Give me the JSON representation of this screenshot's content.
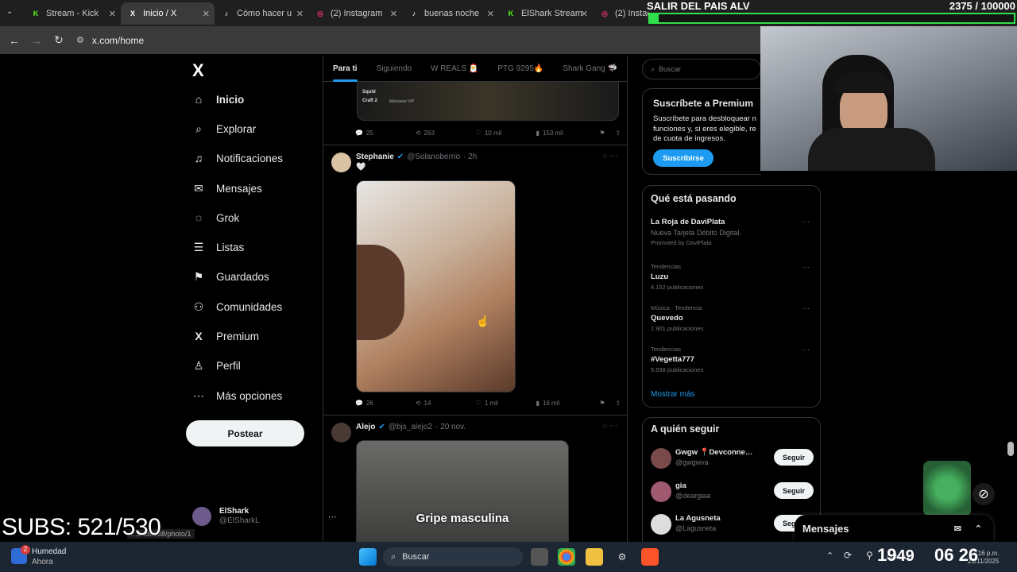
{
  "browser": {
    "tabs": [
      {
        "label": "Stream - Kick",
        "fav": "K",
        "fav_color": "#53fc18"
      },
      {
        "label": "Inicio / X",
        "fav": "X",
        "fav_color": "#ffffff"
      },
      {
        "label": "Cómo hacer u",
        "fav": "♪",
        "fav_color": "#ffffff"
      },
      {
        "label": "(2) Instagram",
        "fav": "◎",
        "fav_color": "#e1306c"
      },
      {
        "label": "buenas noche",
        "fav": "♪",
        "fav_color": "#ffffff"
      },
      {
        "label": "ElShark Stream",
        "fav": "K",
        "fav_color": "#53fc18"
      },
      {
        "label": "(2) Instagram",
        "fav": "◎",
        "fav_color": "#e1306c"
      }
    ],
    "url": "x.com/home",
    "status_link": "…8486038/photo/1"
  },
  "overlay": {
    "goal_text": "SALIR DEL PAIS ALV",
    "goal_count": "2375 / 100000",
    "subs": "SUBS: 521/530"
  },
  "sidebar": {
    "logo": "X",
    "items": [
      {
        "label": "Inicio",
        "icon": "⌂"
      },
      {
        "label": "Explorar",
        "icon": "⌕"
      },
      {
        "label": "Notificaciones",
        "icon": "♫"
      },
      {
        "label": "Mensajes",
        "icon": "✉"
      },
      {
        "label": "Grok",
        "icon": "◌"
      },
      {
        "label": "Listas",
        "icon": "☰"
      },
      {
        "label": "Guardados",
        "icon": "⚑"
      },
      {
        "label": "Comunidades",
        "icon": "⚇"
      },
      {
        "label": "Premium",
        "icon": "X"
      },
      {
        "label": "Perfil",
        "icon": "♙"
      },
      {
        "label": "Más opciones",
        "icon": "⋯"
      }
    ],
    "post_button": "Postear",
    "profile_name": "ElShark",
    "profile_handle": "@ElSharkL"
  },
  "feed": {
    "tabs": [
      "Para ti",
      "Siguiendo",
      "W REALS 🎅",
      "PTG 9295🔥",
      "Shark Gang 🦈"
    ],
    "post0": {
      "media_caption": "Squid Craft 2",
      "media_sub": "Máscaras VIP",
      "replies": "25",
      "reposts": "263",
      "likes": "10 mil",
      "views": "153 mil"
    },
    "post1": {
      "name": "Stephanie",
      "handle": "@Solanoberrio",
      "time": "· 2h",
      "text": "🤍",
      "replies": "26",
      "reposts": "14",
      "likes": "1 mil",
      "views": "16 mil"
    },
    "post2": {
      "name": "Alejo",
      "handle": "@bjs_alejo2",
      "time": "· 20 nov.",
      "media_caption": "Gripe masculina"
    }
  },
  "right": {
    "search_placeholder": "Buscar",
    "premium": {
      "title": "Suscríbete a Premium",
      "body1": "Suscríbete para desbloquear n",
      "body2": "funciones y, si eres elegible, re",
      "body3": "de cuota de ingresos.",
      "button": "Suscribirse"
    },
    "trends_title": "Qué está pasando",
    "trends": [
      {
        "meta": "",
        "name": "La Roja de DaviPlata",
        "sub": "Nueva Tarjeta Débito Digital.",
        "extra": "Promoted by DaviPlata"
      },
      {
        "meta": "Tendencias",
        "name": "Luzu",
        "sub": "4.152 publicaciones",
        "extra": ""
      },
      {
        "meta": "Música · Tendencia",
        "name": "Quevedo",
        "sub": "1.901 publicaciones",
        "extra": ""
      },
      {
        "meta": "Tendencias",
        "name": "#Vegetta777",
        "sub": "5.938 publicaciones",
        "extra": ""
      }
    ],
    "show_more": "Mostrar más",
    "follow_title": "A quién seguir",
    "follow": [
      {
        "name": "Gwgw 📍Devconne…",
        "handle": "@gwgwva",
        "button": "Seguir"
      },
      {
        "name": "gia",
        "handle": "@deargiaa",
        "button": "Seguir"
      },
      {
        "name": "La Agusneta",
        "handle": "@Lagusneta",
        "button": "Seguir"
      }
    ],
    "messages": "Mensajes"
  },
  "taskbar": {
    "weather": "Humedad",
    "weather_sub": "Ahora",
    "search": "Buscar",
    "clock1": "19",
    "clock2": "49",
    "clock3": "06",
    "clock4": "26",
    "time_small": "7:16 p.m.",
    "date_small": "21/11/2025",
    "lang": "ESP LAA",
    "notif_count": "2"
  }
}
